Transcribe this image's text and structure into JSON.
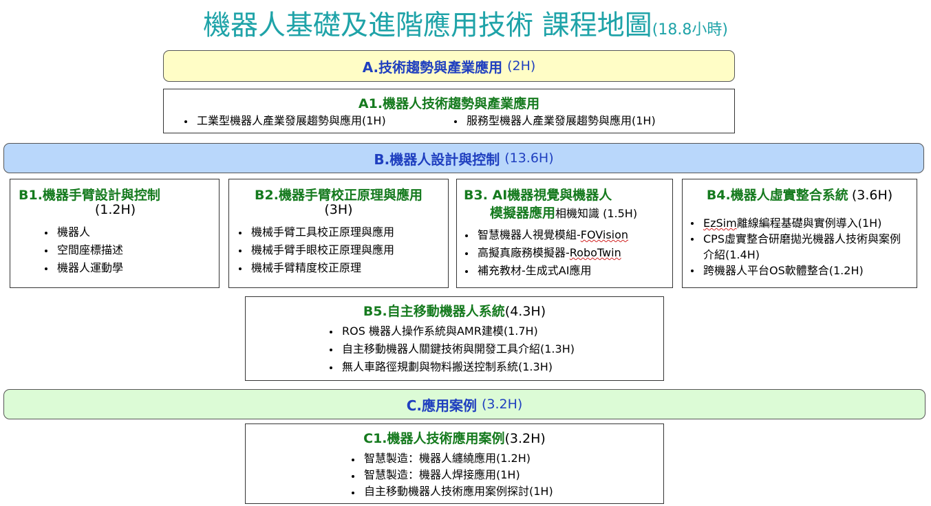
{
  "title": {
    "main": "機器人基礎及進階應用技術 課程地圖",
    "hours": "(18.8小時)"
  },
  "colors": {
    "title": "#1fa3a8",
    "section_title": "#1f3fbf",
    "module_title": "#157a1e",
    "band_a": "#fffdc6",
    "band_b": "#b9d7fb",
    "band_c": "#dcfbd6"
  },
  "section_a": {
    "label": "A.技術趨勢與產業應用",
    "hours": "(2H)",
    "a1": {
      "title": "A1.機器人技術趨勢與產業應用",
      "items": [
        "工業型機器人產業發展趨勢與應用(1H)",
        "服務型機器人產業發展趨勢與應用(1H)"
      ]
    }
  },
  "section_b": {
    "label": "B.機器人設計與控制",
    "hours": "(13.6H)",
    "b1": {
      "title": "B1.機器手臂設計與控制",
      "hours": "(1.2H)",
      "items": [
        "機器人",
        "空間座標描述",
        "機器人運動學"
      ]
    },
    "b2": {
      "title": "B2.機器手臂校正原理與應用",
      "hours": "(3H)",
      "items": [
        "機械手臂工具校正原理與應用",
        "機械手臂手眼校正原理與應用",
        "機械手臂精度校正原理"
      ]
    },
    "b3": {
      "title_line1": "B3. AI機器視覺與機器人",
      "title_line2": "模擬器應用",
      "title_suffix": "相機知識 (1.5H)",
      "items": [
        {
          "prefix": "智慧機器人視覺模組-",
          "mark": "FOVision"
        },
        {
          "prefix": "高擬真廠務模擬器-",
          "mark": "RoboTwin"
        },
        {
          "prefix": "補充教材-生成式AI應用",
          "mark": ""
        }
      ]
    },
    "b4": {
      "title": "B4.機器人虛實整合系統",
      "hours": "(3.6H)",
      "items": [
        {
          "mark": "EzSim",
          "text": "離線編程基礎與實例導入(1H)"
        },
        {
          "mark": "",
          "text": "CPS虛實整合研磨拋光機器人技術與案例介紹(1.4H)"
        },
        {
          "mark": "",
          "text": "跨機器人平台OS軟體整合(1.2H)"
        }
      ]
    },
    "b5": {
      "title": "B5.自主移動機器人系統",
      "hours": "(4.3H)",
      "items": [
        "ROS 機器人操作系統與AMR建模(1.7H)",
        "自主移動機器人關鍵技術與開發工具介紹(1.3H)",
        "無人車路徑規劃與物料搬送控制系統(1.3H)"
      ]
    }
  },
  "section_c": {
    "label": "C.應用案例",
    "hours": "(3.2H)",
    "c1": {
      "title": "C1.機器人技術應用案例",
      "hours": "(3.2H)",
      "items": [
        "智慧製造：機器人纏繞應用(1.2H)",
        "智慧製造：機器人焊接應用(1H)",
        "自主移動機器人技術應用案例探討(1H)"
      ]
    }
  }
}
